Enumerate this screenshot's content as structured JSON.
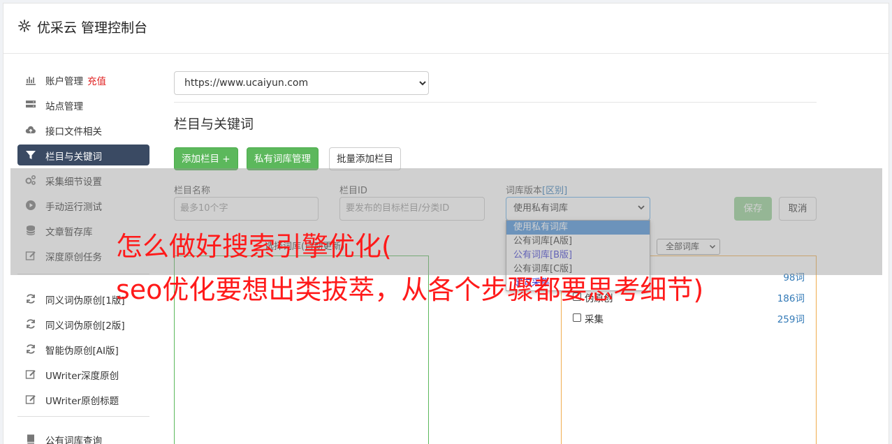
{
  "header": {
    "title": "优采云 管理控制台",
    "icon": "gear-icon"
  },
  "sidebar": {
    "items": [
      {
        "label": "账户管理",
        "extra": "充值",
        "icon": "bar-chart-icon"
      },
      {
        "label": "站点管理",
        "icon": "server-icon"
      },
      {
        "label": "接口文件相关",
        "icon": "cloud-upload-icon"
      },
      {
        "label": "栏目与关键词",
        "icon": "filter-icon",
        "active": true
      },
      {
        "label": "采集细节设置",
        "icon": "gears-icon"
      },
      {
        "label": "手动运行测试",
        "icon": "play-icon"
      },
      {
        "label": "文章暂存库",
        "icon": "database-icon"
      },
      {
        "label": "深度原创任务",
        "icon": "edit-icon"
      },
      {
        "label": "同义词伪原创[1版]",
        "icon": "refresh-icon"
      },
      {
        "label": "同义词伪原创[2版]",
        "icon": "refresh-icon"
      },
      {
        "label": "智能伪原创[AI版]",
        "icon": "refresh-icon"
      },
      {
        "label": "UWriter深度原创",
        "icon": "edit-icon"
      },
      {
        "label": "UWriter原创标题",
        "icon": "edit-icon"
      },
      {
        "label": "公有词库查询",
        "icon": "book-icon"
      }
    ]
  },
  "main": {
    "site_select": "https://www.ucaiyun.com",
    "section_title": "栏目与关键词",
    "buttons": {
      "add_column": "添加栏目 +",
      "private_lib": "私有词库管理",
      "batch_add": "批量添加栏目"
    },
    "form": {
      "name_label": "栏目名称",
      "name_placeholder": "最多10个字",
      "id_label": "栏目ID",
      "id_placeholder": "要发布的目标栏目/分类ID",
      "lib_label": "词库版本",
      "lib_label_link": "[区别]",
      "lib_value": "使用私有词库",
      "save": "保存",
      "cancel": "取消"
    },
    "dropdown_options": [
      "使用私有词库",
      "公有词库[A版]",
      "公有词库[B版]",
      "公有词库[C版]",
      "定向采集"
    ],
    "hint": "选择词库(自动更新)",
    "all_lib": "全部词库",
    "libs": [
      {
        "name": "",
        "count": "98词"
      },
      {
        "name": "伪原创",
        "count": "186词"
      },
      {
        "name": "采集",
        "count": "259词"
      }
    ]
  },
  "caption": {
    "line1": "怎么做好搜索引擎优化(",
    "line2": "seo优化要想出类拔萃，从各个步骤都要思考细节)"
  },
  "colors": {
    "active_nav": "#3a4a63",
    "green": "#5cb85c",
    "caption": "#ff1a1a",
    "link": "#337ab7"
  }
}
